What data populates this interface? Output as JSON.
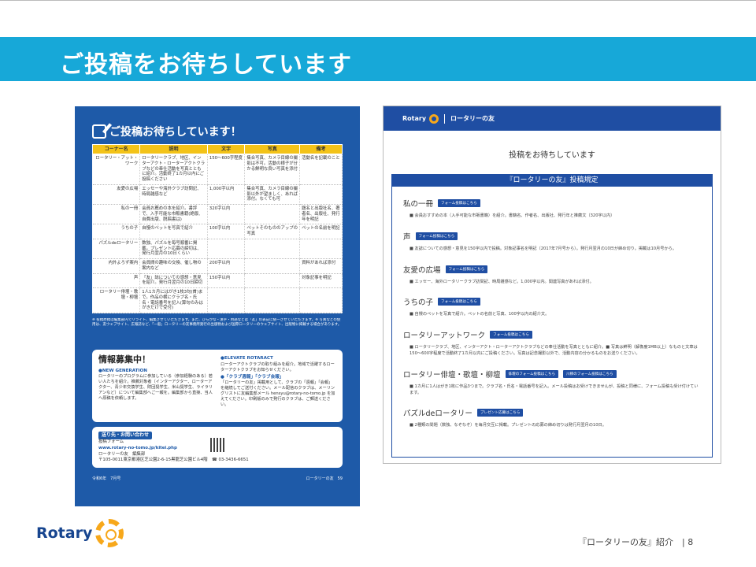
{
  "slide": {
    "title": "ご投稿をお待ちしています",
    "footer": "『ロータリーの友』紹介　| 8"
  },
  "magazine": {
    "heading": "ご投稿お待ちしています！",
    "columns": [
      "コーナー名",
      "説明",
      "文字",
      "写真",
      "備考"
    ],
    "rows": [
      [
        "ロータリー・アット・ワーク",
        "ロータリークラブ、地区、インターアクト・ローターアクトクラブなどの奉仕活動を写真とともに紹介。活動終了1カ月以内にご投稿ください",
        "150〜600字程度",
        "集合写真、カメラ目線の撮影は不可。活動の様子が分かる鮮明な良い写真を添付",
        "活動名を記載のこと"
      ],
      [
        "友愛の広場",
        "エッセーや海外クラブ訪問記、時局雑感など",
        "1,000字以内",
        "集合写真、カメラ目線の撮影以外が望ましく、あれば添付。なくても可",
        ""
      ],
      [
        "私の一冊",
        "会員お薦めの本を紹介。書評で、入手可能な市販書籍(絶版、自費出版、脱稿書は)",
        "320字以内",
        "",
        "題名と出版社名、著者名、出版社、発行年を明記"
      ],
      [
        "うちの子",
        "自慢のペットを写真で紹介",
        "100字以内",
        "ペットそのもののアップの写真",
        "ペットの名前を明記"
      ],
      [
        "パズルdeロータリー",
        "数独、パズルを毎号順番に掲載。プレゼント応募の締切は、発行月翌月の10日くらい",
        "",
        "",
        ""
      ],
      [
        "内外よろず案内",
        "会員間の趣味の交換、催し物の案内など",
        "200字以内",
        "",
        "資料があれば添付"
      ],
      [
        "声",
        "「友」誌についての感想・意見を紹介。発行月翌月の10日締切",
        "150字以内",
        "",
        "対象記事を明記"
      ],
      [
        "ロータリー俳壇・歌壇・柳壇",
        "1人1カ月にはがき1枚3句(首)まで。作品の横にクラブ名・氏名・電話番号を記入(算句のみはがきだけで受付)",
        "",
        "",
        ""
      ]
    ],
    "notes": "※ 投稿原稿は編集部内でリライト、編集させていただきます。また、ひらがな・漢字・用語などは「友」の表記に統一させていただきます。※ 写真などの使用は、友ウェブサイト、広報誌など、「一般」ロータリーの友事務所発行の出版物および国際ロータリーのウェブサイト、出版物に掲載する場合があります。",
    "info_title": "情報募集中！",
    "info_left_sub": "●NEW GENERATION",
    "info_left_text": "ロータリーのプログラムに参加している（参加経験のある）若い人たちを紹介。推薦対象者（インターアクター、ローターアクター、青少年交換学生、財団奨学生、米山奨学生、ライラリアンなど）について編集部へご一報を。編集部から直接、当人へ原稿を依頼します。",
    "info_right_sub1": "●ELEVATE ROTARACT",
    "info_right_text1": "ローターアクトクラブの取り組みを紹介。地域で活躍するローターアクトクラブをお知らせください。",
    "info_right_sub2": "●「クラブ週報」「クラブ会報」",
    "info_right_text2": "「ロータリーの友」掲載用として、クラブの「週報」「会報」を継続してご送付ください。メール配信のクラブは、メーリングリストに友編集部メール hensyu@rotary-no-tomo.jp を加えてください。印刷版のみで発行のクラブは、ご郵送ください。",
    "contact_tag": "送り先・お問い合わせ",
    "contact_form": "投稿フォーム",
    "contact_url": "www.rotary-no-tomo.jp/kitei.php",
    "contact_org": "ロータリーの友　編集部",
    "contact_addr": "〒105-0011東京都港区芝公園2-6-15黒龍芝公園ビル4階",
    "contact_tel": "☎ 03-3436-6651",
    "foot_left": "令和6年　7月号",
    "foot_right": "ロータリーの友　59"
  },
  "web": {
    "brand": "Rotary",
    "brand_jp": "ロータリーの友",
    "title": "投稿をお待ちしています",
    "box_title": "『ロータリーの友』投稿規定",
    "sections": [
      {
        "name": "私の一冊",
        "button": "フォーム投稿はこちら",
        "text": "■ 会員おすすめの本（入手可能な市販書籍）を紹介。書籍名、作者名、出版社、発行年と推薦文（320字以内）"
      },
      {
        "name": "声",
        "button": "フォーム投稿はこちら",
        "text": "■ 友誌についての感想・意見を150字以内で投稿。対象記事名を明記（2017年7月号から）。発行月翌月の10日が締め切り。掲載は10月号から。"
      },
      {
        "name": "友愛の広場",
        "button": "フォーム投稿はこちら",
        "text": "■ エッセー、海外ロータリークラブ訪問記、時局雑感など。1,000字以内。関連写真があれば添付。"
      },
      {
        "name": "うちの子",
        "button": "フォーム投稿はこちら",
        "text": "■ 自慢のペットを写真で紹介。ペットの名前と写真、100字以内の紹介文。"
      },
      {
        "name": "ロータリーアットワーク",
        "button": "フォーム投稿はこちら",
        "text": "■ ロータリークラブ、地区、インターアクト・ローターアクトクラブなどの奉仕活動を写真とともに紹介。■ 写真は鮮明（解像度1MB以上）なものと文章は150〜600字程度で活動終了1カ月以内にご投稿ください。写真は記念撮影以外で、活動内容の分かるものをお送りください。"
      },
      {
        "name": "ロータリー俳壇・歌壇・柳壇",
        "button": "俳壇のフォーム投稿はこちら",
        "button2": "川柳のフォーム投稿はこちら",
        "text": "■ 1カ月に1人はがき1枚に作品3つまで。クラブ名・氏名・電話番号を記入。メール投稿はお受けできませんが、投稿と同様に、フォーム投稿も受け付けています。"
      },
      {
        "name": "パズルdeロータリー",
        "button": "プレゼント応募はこちら",
        "text": "■ 2種類の問題（数独、なぞなぞ）を毎月交互に掲載。プレゼントの応募の締め切りは発行月翌月の10日。"
      }
    ]
  },
  "logo": {
    "word": "Rotary"
  }
}
